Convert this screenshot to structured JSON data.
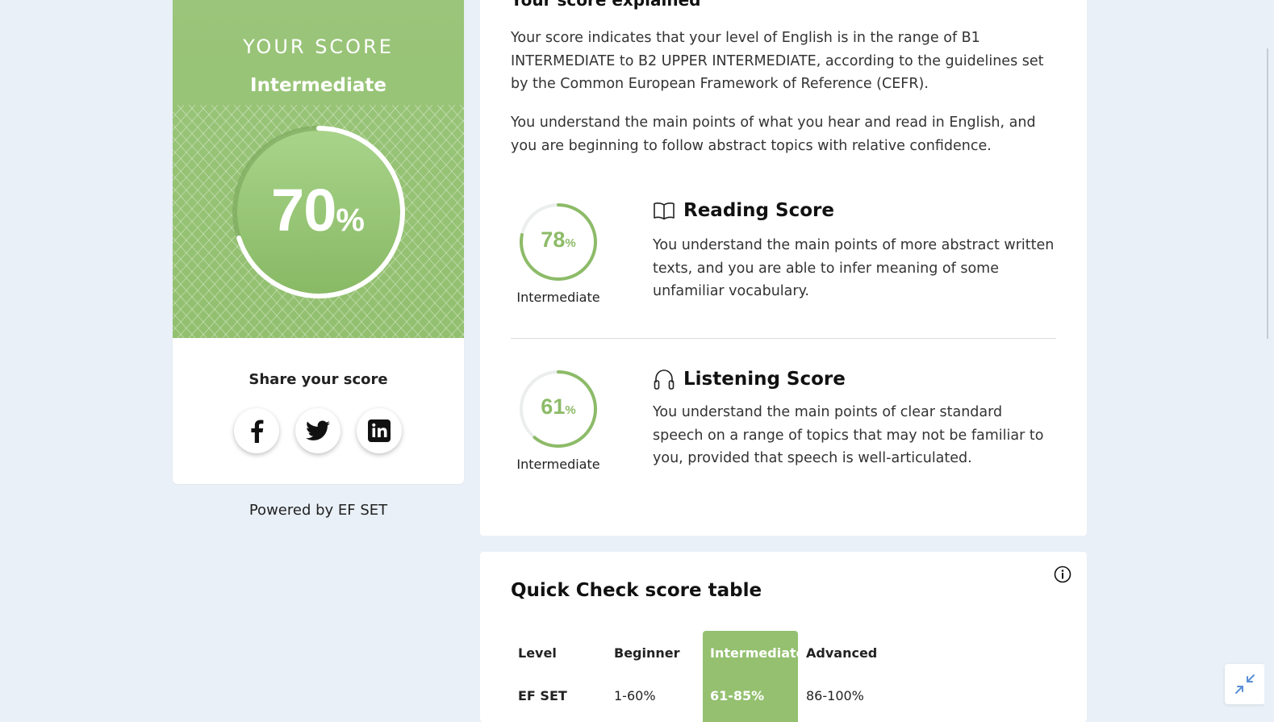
{
  "score_card": {
    "heading": "YOUR SCORE",
    "level": "Intermediate",
    "score_number": "70",
    "score_percent_sign": "%",
    "score_fraction": 0.7,
    "share_title": "Share your score",
    "share_buttons": [
      "facebook-icon",
      "twitter-icon",
      "linkedin-icon"
    ]
  },
  "powered_by": "Powered by EF SET",
  "explain": {
    "title": "Your score explained",
    "paragraph1": "Your score indicates that your level of English is in the range of B1 INTERMEDIATE to B2 UPPER INTERMEDIATE, according to the guidelines set by the Common European Framework of Reference (CEFR).",
    "paragraph2": "You understand the main points of what you hear and read in English, and you are beginning to follow abstract topics with relative confidence.",
    "reading": {
      "title": "Reading Score",
      "icon": "book-icon",
      "score_number": "78",
      "percent_sign": "%",
      "fraction": 0.78,
      "level": "Intermediate",
      "description": "You understand the main points of more abstract written texts, and you are able to infer meaning of some unfamiliar vocabulary."
    },
    "listening": {
      "title": "Listening Score",
      "icon": "headphones-icon",
      "score_number": "61",
      "percent_sign": "%",
      "fraction": 0.61,
      "level": "Intermediate",
      "description": "You understand the main points of clear standard speech on a range of topics that may not be familiar to you, provided that speech is well-articulated."
    }
  },
  "score_table": {
    "title": "Quick Check score table",
    "headers": [
      "Level",
      "Beginner",
      "Intermediate",
      "Advanced"
    ],
    "row": [
      "EF SET",
      "1-60%",
      "61-85%",
      "86-100%"
    ],
    "highlighted_column": "Intermediate"
  },
  "colors": {
    "accent_green": "#94c070",
    "page_bg": "#e9f0f7"
  }
}
